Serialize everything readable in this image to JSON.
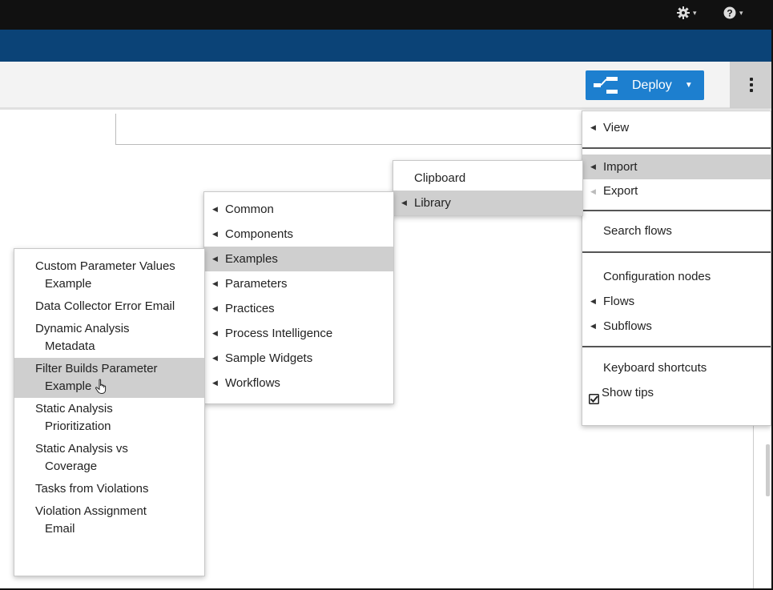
{
  "topbar": {
    "settings_icon": "gear-icon",
    "help_icon": "help-icon"
  },
  "toolbar": {
    "deploy_label": "Deploy",
    "deploy_icon": "deploy-icon",
    "menu_icon": "menu-kebab-icon"
  },
  "colors": {
    "topbar": "#111111",
    "bluebar": "#0b4377",
    "deploy": "#1d7fcf",
    "highlight": "#cfcfcf"
  },
  "main_menu": {
    "view": "View",
    "import": "Import",
    "export": "Export",
    "search_flows": "Search flows",
    "configuration_nodes": "Configuration nodes",
    "flows": "Flows",
    "subflows": "Subflows",
    "keyboard_shortcuts": "Keyboard shortcuts",
    "show_tips": "Show tips"
  },
  "import_menu": {
    "clipboard": "Clipboard",
    "library": "Library"
  },
  "library_menu": [
    "Common",
    "Components",
    "Examples",
    "Parameters",
    "Practices",
    "Process Intelligence",
    "Sample Widgets",
    "Workflows"
  ],
  "examples_menu": [
    {
      "line1": "Custom Parameter Values",
      "line2": "Example"
    },
    {
      "line1": "Data Collector Error Email",
      "line2": ""
    },
    {
      "line1": "Dynamic Analysis",
      "line2": "Metadata"
    },
    {
      "line1": "Filter Builds Parameter",
      "line2": "Example"
    },
    {
      "line1": "Static Analysis",
      "line2": "Prioritization"
    },
    {
      "line1": "Static Analysis vs",
      "line2": "Coverage"
    },
    {
      "line1": "Tasks from Violations",
      "line2": ""
    },
    {
      "line1": "Violation Assignment",
      "line2": "Email"
    }
  ]
}
